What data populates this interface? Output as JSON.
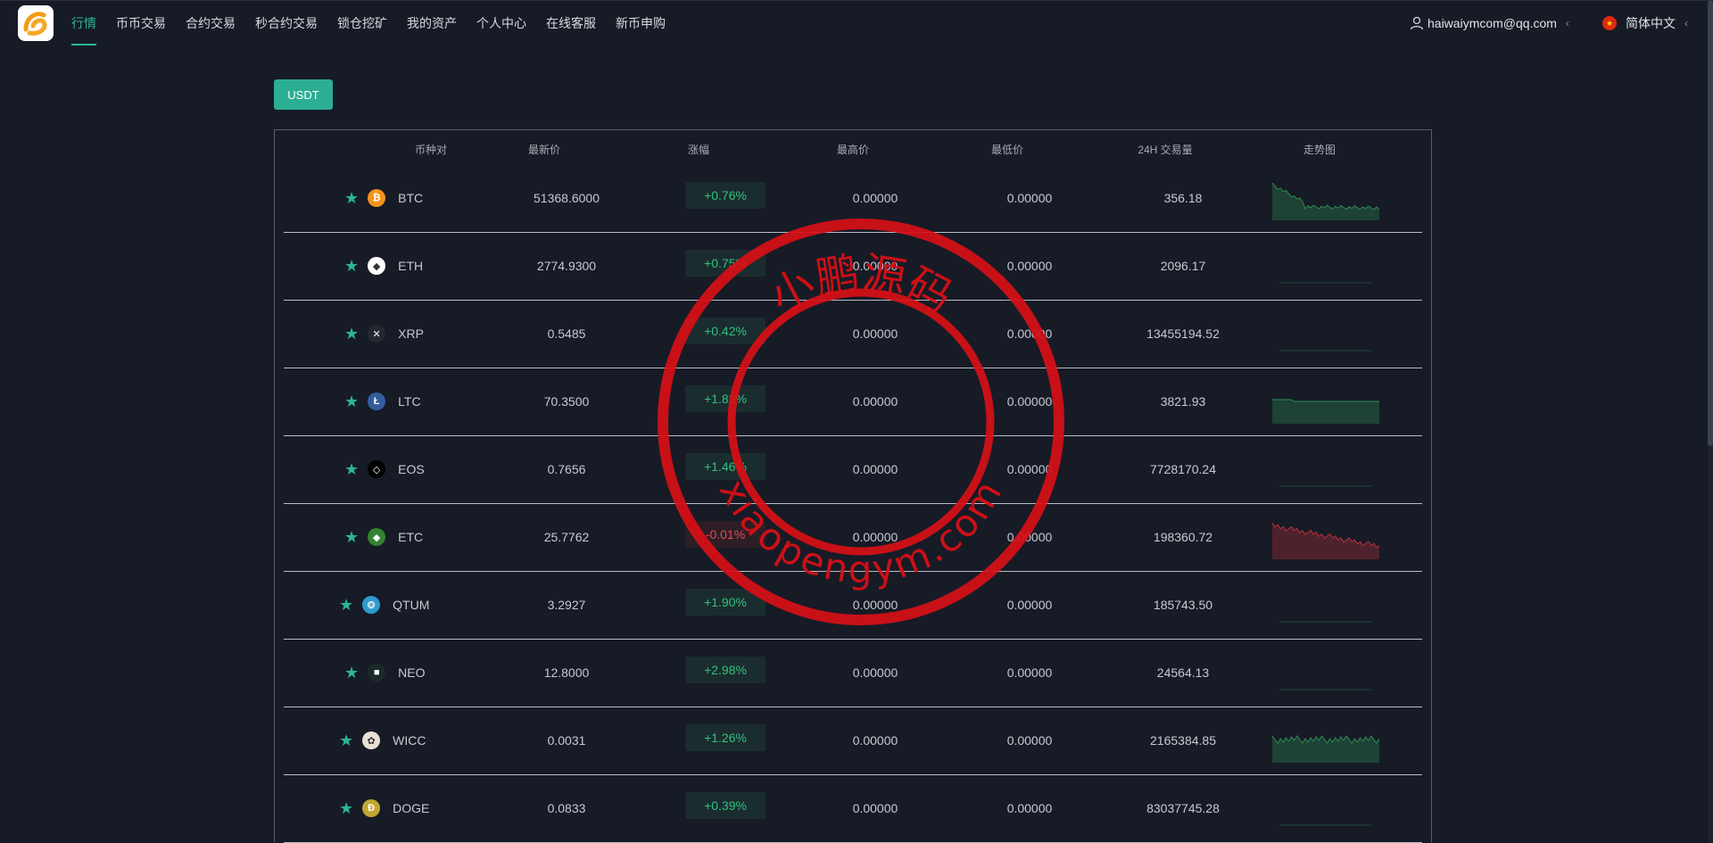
{
  "nav": {
    "items": [
      "行情",
      "币币交易",
      "合约交易",
      "秒合约交易",
      "锁仓挖矿",
      "我的资产",
      "个人中心",
      "在线客服",
      "新币申购"
    ],
    "active_index": 0
  },
  "user": {
    "email": "haiwaiymcom@qq.com"
  },
  "lang": {
    "label": "简体中文"
  },
  "tabs": {
    "usdt": "USDT"
  },
  "table": {
    "headers": {
      "pair": "币种对",
      "last": "最新价",
      "change": "涨幅",
      "high": "最高价",
      "low": "最低价",
      "volume": "24H 交易量",
      "trend": "走势图"
    },
    "rows": [
      {
        "symbol": "BTC",
        "last": "51368.6000",
        "change": "+0.76%",
        "dir": "up",
        "high": "0.00000",
        "low": "0.00000",
        "volume": "356.18",
        "icon": "btc-icon",
        "color": "#f7931a",
        "glyph": "₿",
        "trend": "up-volatile"
      },
      {
        "symbol": "ETH",
        "last": "2774.9300",
        "change": "+0.75%",
        "dir": "up",
        "high": "0.00000",
        "low": "0.00000",
        "volume": "2096.17",
        "icon": "eth-icon",
        "color": "#ffffff",
        "glyph": "◆",
        "trend": "flat"
      },
      {
        "symbol": "XRP",
        "last": "0.5485",
        "change": "+0.42%",
        "dir": "up",
        "high": "0.00000",
        "low": "0.00000",
        "volume": "13455194.52",
        "icon": "xrp-icon",
        "color": "#23292f",
        "glyph": "✕",
        "trend": "flat"
      },
      {
        "symbol": "LTC",
        "last": "70.3500",
        "change": "+1.82%",
        "dir": "up",
        "high": "0.00000",
        "low": "0.00000",
        "volume": "3821.93",
        "icon": "ltc-icon",
        "color": "#345d9d",
        "glyph": "Ł",
        "trend": "up-band"
      },
      {
        "symbol": "EOS",
        "last": "0.7656",
        "change": "+1.46%",
        "dir": "up",
        "high": "0.00000",
        "low": "0.00000",
        "volume": "7728170.24",
        "icon": "eos-icon",
        "color": "#000000",
        "glyph": "◇",
        "trend": "flat"
      },
      {
        "symbol": "ETC",
        "last": "25.7762",
        "change": "-0.01%",
        "dir": "down",
        "high": "0.00000",
        "low": "0.00000",
        "volume": "198360.72",
        "icon": "etc-icon",
        "color": "#328332",
        "glyph": "◆",
        "trend": "down-volatile"
      },
      {
        "symbol": "QTUM",
        "last": "3.2927",
        "change": "+1.90%",
        "dir": "up",
        "high": "0.00000",
        "low": "0.00000",
        "volume": "185743.50",
        "icon": "qtum-icon",
        "color": "#2e9ad0",
        "glyph": "❂",
        "trend": "flat"
      },
      {
        "symbol": "NEO",
        "last": "12.8000",
        "change": "+2.98%",
        "dir": "up",
        "high": "0.00000",
        "low": "0.00000",
        "volume": "24564.13",
        "icon": "neo-icon",
        "color": "#1b2a28",
        "glyph": "■",
        "trend": "flat"
      },
      {
        "symbol": "WICC",
        "last": "0.0031",
        "change": "+1.26%",
        "dir": "up",
        "high": "0.00000",
        "low": "0.00000",
        "volume": "2165384.85",
        "icon": "wicc-icon",
        "color": "#e8e2d6",
        "glyph": "✿",
        "trend": "up-noisy"
      },
      {
        "symbol": "DOGE",
        "last": "0.0833",
        "change": "+0.39%",
        "dir": "up",
        "high": "0.00000",
        "low": "0.00000",
        "volume": "83037745.28",
        "icon": "doge-icon",
        "color": "#c2a633",
        "glyph": "Ð",
        "trend": "flat"
      }
    ]
  },
  "watermark": {
    "top": "小鹏源码",
    "bottom": "xiaopengym.com"
  },
  "colors": {
    "accent": "#2bb59a",
    "up": "#2ec27e",
    "down": "#e24a57",
    "bg": "#161b26",
    "stamp": "#d80f16"
  }
}
